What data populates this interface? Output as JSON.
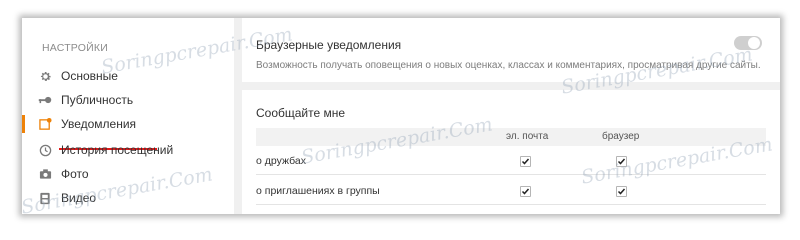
{
  "sidebar": {
    "title": "НАСТРОЙКИ",
    "items": [
      {
        "label": "Основные",
        "icon": "gear-icon"
      },
      {
        "label": "Публичность",
        "icon": "key-icon"
      },
      {
        "label": "Уведомления",
        "icon": "notification-icon",
        "active": true
      },
      {
        "label": "История посещений",
        "icon": "history-icon"
      },
      {
        "label": "Фото",
        "icon": "camera-icon"
      },
      {
        "label": "Видео",
        "icon": "video-icon"
      }
    ]
  },
  "browser_notifications": {
    "title": "Браузерные уведомления",
    "description": "Возможность получать оповещения о новых оценках, классах и комментариях, просматривая другие сайты.",
    "toggle_on": false
  },
  "notify_me": {
    "title": "Сообщайте мне",
    "columns": [
      "эл. почта",
      "браузер"
    ],
    "rows": [
      {
        "label": "о дружбах",
        "email": true,
        "browser": true
      },
      {
        "label": "о приглашениях в группы",
        "email": true,
        "browser": true
      }
    ]
  },
  "watermark": "Soringpcrepair.Com",
  "colors": {
    "accent": "#ee8208",
    "highlight_underline": "#e01a1a"
  }
}
